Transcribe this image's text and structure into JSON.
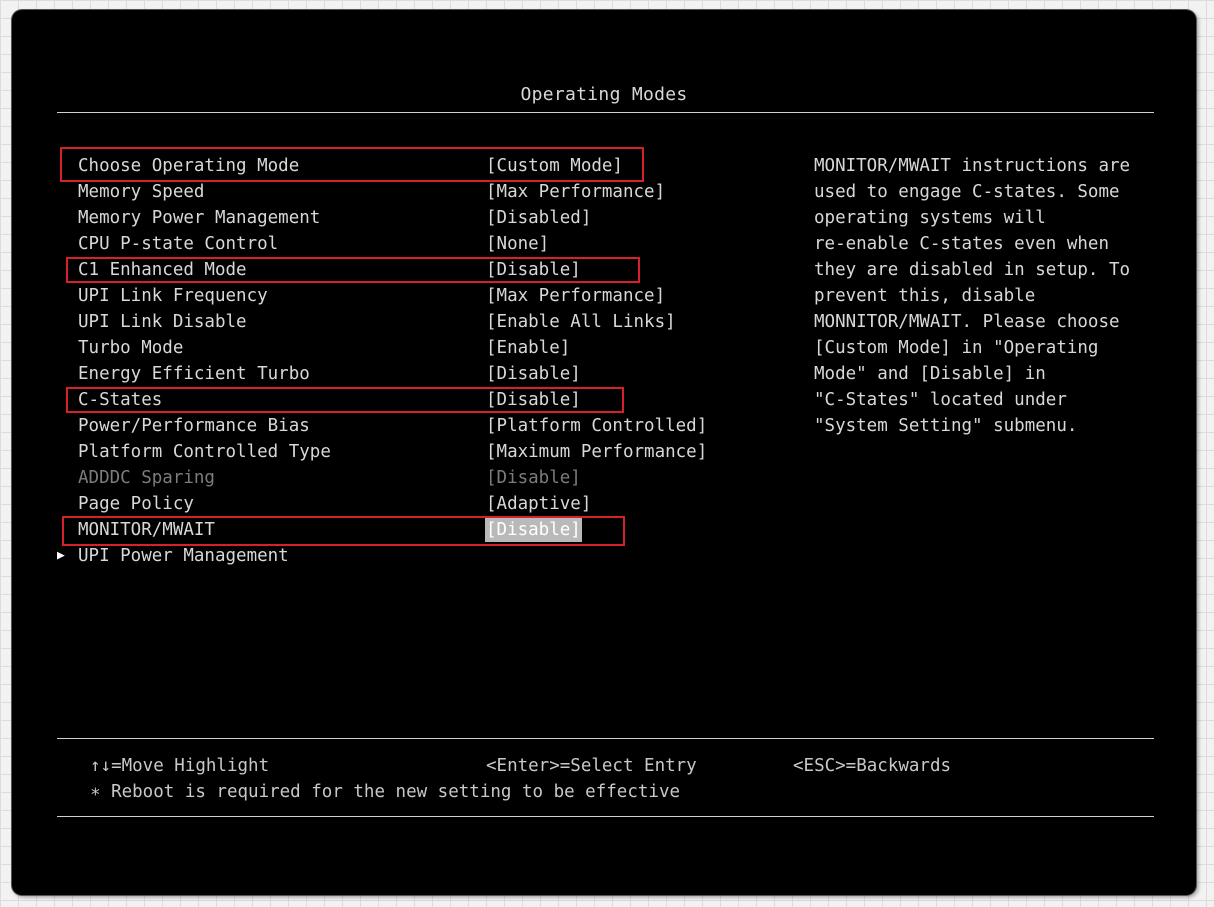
{
  "window": {
    "title": "Operating Modes"
  },
  "settings": [
    {
      "name": "Choose Operating Mode",
      "value": "[Custom Mode]"
    },
    {
      "name": "Memory Speed",
      "value": "[Max Performance]"
    },
    {
      "name": "Memory Power Management",
      "value": "[Disabled]"
    },
    {
      "name": "CPU P-state Control",
      "value": "[None]"
    },
    {
      "name": "C1 Enhanced Mode",
      "value": "[Disable]"
    },
    {
      "name": "UPI Link Frequency",
      "value": "[Max Performance]"
    },
    {
      "name": "UPI Link Disable",
      "value": "[Enable All Links]"
    },
    {
      "name": "Turbo Mode",
      "value": "[Enable]"
    },
    {
      "name": "Energy Efficient Turbo",
      "value": "[Disable]"
    },
    {
      "name": "C-States",
      "value": "[Disable]"
    },
    {
      "name": "Power/Performance Bias",
      "value": "[Platform Controlled]"
    },
    {
      "name": "Platform Controlled Type",
      "value": "[Maximum Performance]"
    },
    {
      "name": "ADDDC Sparing",
      "value": "[Disable]"
    },
    {
      "name": "Page Policy",
      "value": "[Adaptive]"
    },
    {
      "name": "MONITOR/MWAIT",
      "value": "[Disable]"
    }
  ],
  "submenu": {
    "label": "UPI Power Management"
  },
  "help": {
    "lines": [
      "MONITOR/MWAIT instructions are",
      "used to engage C-states. Some",
      "operating systems will",
      "re-enable C-states even when",
      "they are disabled in setup. To",
      "prevent this, disable",
      "MONNITOR/MWAIT. Please choose",
      "[Custom Mode] in \"Operating",
      "Mode\" and [Disable] in",
      "\"C-States\" located under",
      "\"System Setting\" submenu."
    ]
  },
  "footer": {
    "move": "↑↓=Move Highlight",
    "select": "<Enter>=Select Entry",
    "back": "<ESC>=Backwards",
    "note": "∗ Reboot is required for the new setting to be effective"
  },
  "colors": {
    "background": "#000000",
    "text": "#d8d8d8",
    "disabled_text": "#7c7c7c",
    "selection": "#b9b9b9",
    "highlight_box": "#d8202a"
  },
  "state": {
    "selected_item": "MONITOR/MWAIT",
    "disabled_item": "ADDDC Sparing",
    "highlighted_items": [
      "Choose Operating Mode",
      "C1 Enhanced Mode",
      "C-States",
      "MONITOR/MWAIT"
    ]
  }
}
